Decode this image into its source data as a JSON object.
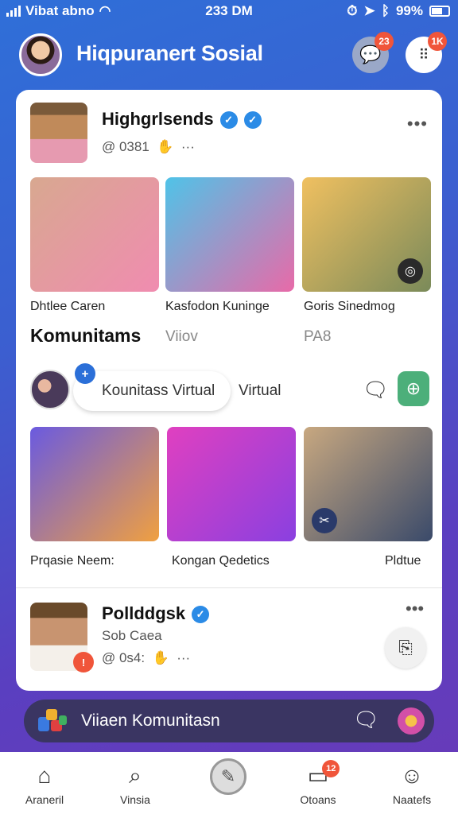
{
  "status_bar": {
    "carrier": "Vibat abno",
    "time": "233 DM",
    "battery_text": "99%"
  },
  "header": {
    "title": "Hiqpuranert Sosial",
    "chat_badge": "23",
    "grid_badge": "1K"
  },
  "post1": {
    "name": "Highgrlsends",
    "meta": "@ 0381",
    "media": [
      {
        "label": "Dhtlee Caren",
        "colors": [
          "#d8a890",
          "#f08cb0"
        ]
      },
      {
        "label": "Kasfodon Kuninge",
        "colors": [
          "#4fc3e8",
          "#e86aa8"
        ]
      },
      {
        "label": "Goris Sinedmog",
        "colors": [
          "#f0c060",
          "#7a8a5a"
        ]
      }
    ]
  },
  "community": {
    "title": "Komunitams",
    "sub1": "Viiov",
    "sub2": "PA8",
    "pill_text": "Kounitass Virtual",
    "side_text": "Virtual",
    "media": [
      {
        "label": "Prqasie Neem:",
        "colors": [
          "#6a5ae0",
          "#f0a040"
        ]
      },
      {
        "label": "Kongan Qedetics",
        "colors": [
          "#e040c0",
          "#8a40e0"
        ]
      },
      {
        "label": "Pldtue",
        "colors": [
          "#c8a880",
          "#3a4a6a"
        ]
      }
    ]
  },
  "post2": {
    "name": "Pollddgsk",
    "subtitle": "Sob Caea",
    "meta": "@ 0s4:",
    "badge": "!"
  },
  "compose": {
    "placeholder": "Viiaen Komunitasn",
    "block_colors": [
      "#3a7ae0",
      "#f0b030",
      "#e04040",
      "#40b060"
    ]
  },
  "nav": {
    "items": [
      {
        "label": "Araneril",
        "icon": "home-icon"
      },
      {
        "label": "Vinsia",
        "icon": "search-icon"
      },
      {
        "label": "",
        "icon": "compose-icon"
      },
      {
        "label": "Otoans",
        "icon": "messages-icon",
        "badge": "12"
      },
      {
        "label": "Naatefs",
        "icon": "profile-icon"
      }
    ]
  }
}
